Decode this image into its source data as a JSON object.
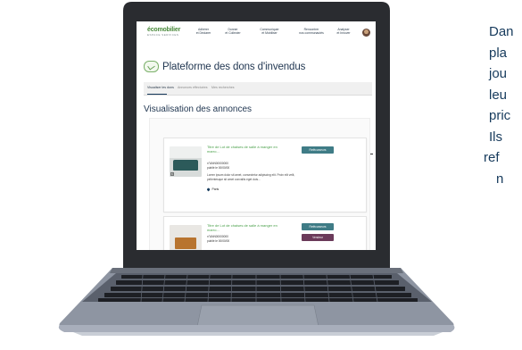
{
  "app": {
    "logo_main": "écomobilier",
    "logo_sub": "ESPACE SERVICES"
  },
  "nav": {
    "items": [
      {
        "label": "Adhérer\net Déclarer"
      },
      {
        "label": "Donner\net Collecter"
      },
      {
        "label": "Communiquer\net Mobiliser"
      },
      {
        "label": "Rencontrer\nnos communautés"
      },
      {
        "label": "Analyser\net Innover"
      }
    ]
  },
  "page": {
    "title": "Plateforme des dons d'invendus",
    "section_title": "Visualisation des annonces",
    "tabs": [
      {
        "label": "Visualiser les dons",
        "active": true
      },
      {
        "label": "Annonces effectuées",
        "active": false
      },
      {
        "label": "Mes recherches",
        "active": false
      }
    ]
  },
  "listings": [
    {
      "title": "Titre de Lot de chaises de salle à manger en marro...",
      "meta1": "n°ANN00000000",
      "meta2": "publié le 00/00/00",
      "description": "Lorem ipsum dolor sit amet, consectetur adipiscing elit. Proin elit velit, pellentesque sit amet convallis eget duis...",
      "location": "Paris",
      "image_badge": "6",
      "primary_button": "Refécurseurs",
      "secondary_button": ""
    },
    {
      "title": "Titre de Lot de chaises de salle à manger en marro...",
      "meta1": "n°ANN00000000",
      "meta2": "publié le 00/00/00",
      "description": "",
      "location": "",
      "image_badge": "",
      "primary_button": "Refécurseurs",
      "secondary_button": "Vendeur"
    }
  ],
  "side_text": {
    "lines": [
      "Dan",
      "pla",
      "jou",
      "leu",
      "pric",
      "Ils",
      "ref",
      "n"
    ]
  },
  "colors": {
    "brand_green": "#4a8a3c",
    "brand_navy": "#163a5c",
    "listing_title_green": "#4aa04a",
    "button_teal": "#3f7c86",
    "button_purple": "#6b3a5a",
    "laptop_frame": "#2b2d31",
    "laptop_base": "#8f96a3"
  }
}
